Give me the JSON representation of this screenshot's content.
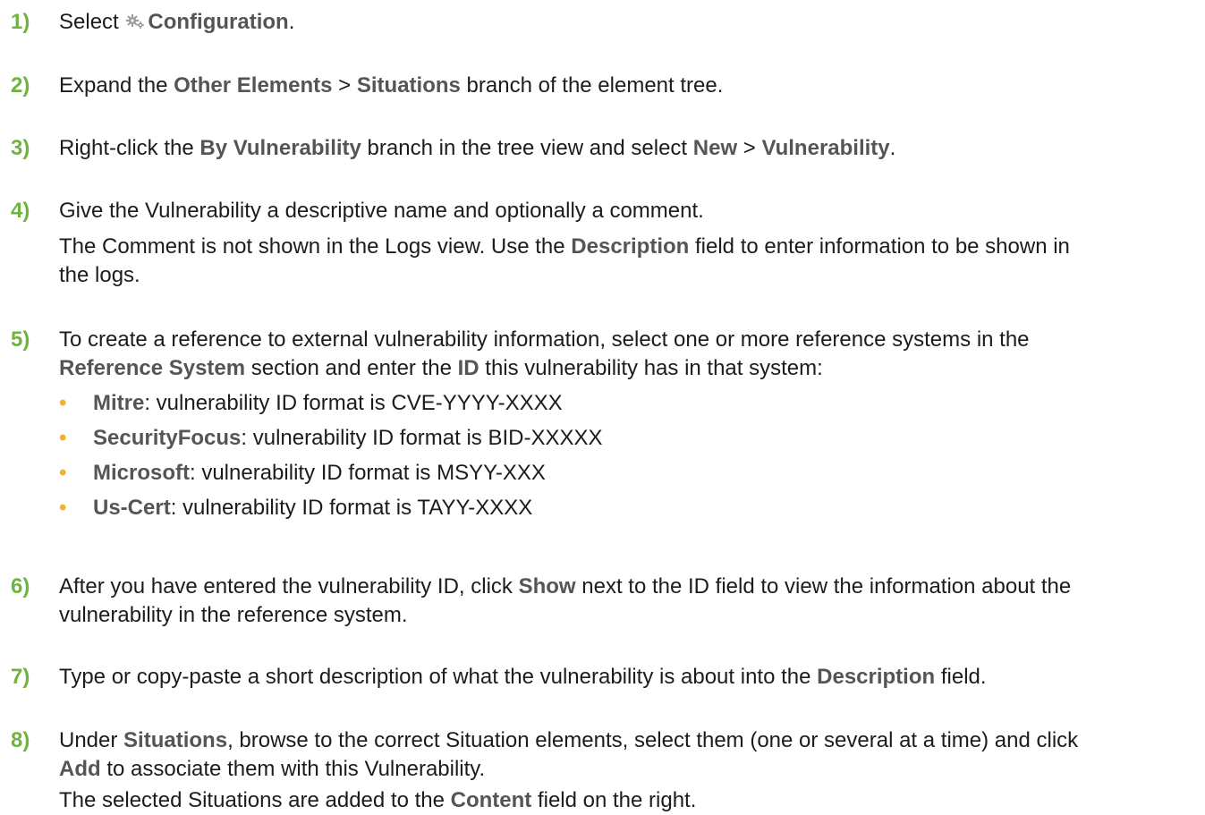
{
  "steps": [
    {
      "number": "1)",
      "line1": {
        "pre": "Select ",
        "bold": "Configuration",
        "post": "."
      }
    },
    {
      "number": "2)",
      "line1": {
        "pre": "Expand the ",
        "bold1": "Other Elements",
        "mid": " > ",
        "bold2": "Situations",
        "post": " branch of the element tree."
      }
    },
    {
      "number": "3)",
      "line1": {
        "pre": "Right-click the ",
        "bold1": "By Vulnerability",
        "mid1": " branch in the tree view and select ",
        "bold2": "New",
        "mid2": " > ",
        "bold3": "Vulnerability",
        "post": "."
      }
    },
    {
      "number": "4)",
      "line1": "Give the Vulnerability a descriptive name and optionally a comment.",
      "note": {
        "pre": "The Comment is not shown in the Logs view. Use the ",
        "bold": "Description",
        "post1": " field to enter information to be shown in",
        "post2": "the logs."
      }
    },
    {
      "number": "5)",
      "line1": "To create a reference to external vulnerability information, select one or more reference systems in the",
      "line2": {
        "bold1": "Reference System",
        "mid": " section and enter the ",
        "bold2": "ID",
        "post": " this vulnerability has in that system:"
      },
      "bullets": [
        {
          "bullet": "•",
          "name": "Mitre",
          "text": ": vulnerability ID format is CVE-YYYY-XXXX"
        },
        {
          "bullet": "•",
          "name": "SecurityFocus",
          "text": ": vulnerability ID format is BID-XXXXX"
        },
        {
          "bullet": "•",
          "name": "Microsoft",
          "text": ": vulnerability ID format is MSYY-XXX"
        },
        {
          "bullet": "•",
          "name": "Us-Cert",
          "text": ": vulnerability ID format is TAYY-XXXX"
        }
      ]
    },
    {
      "number": "6)",
      "line1": {
        "pre": "After you have entered the vulnerability ID, click ",
        "bold": "Show",
        "post": " next to the ID field to view the information about the"
      },
      "line2": "vulnerability in the reference system."
    },
    {
      "number": "7)",
      "line1": {
        "pre": "Type or copy-paste a short description of what the vulnerability is about into the ",
        "bold": "Description",
        "post": " field."
      }
    },
    {
      "number": "8)",
      "line1": {
        "pre": "Under ",
        "bold": "Situations",
        "post": ", browse to the correct Situation elements, select them (one or several at a time) and click"
      },
      "line2": {
        "bold": "Add",
        "post": " to associate them with this Vulnerability."
      },
      "note": {
        "pre": "The selected Situations are added to the ",
        "bold": "Content",
        "post": " field on the right."
      }
    }
  ],
  "icons": {
    "configuration": "gear-icon"
  },
  "colors": {
    "step_number": "#6fb43f",
    "bullet": "#f0b233",
    "emphasis": "#555555"
  }
}
